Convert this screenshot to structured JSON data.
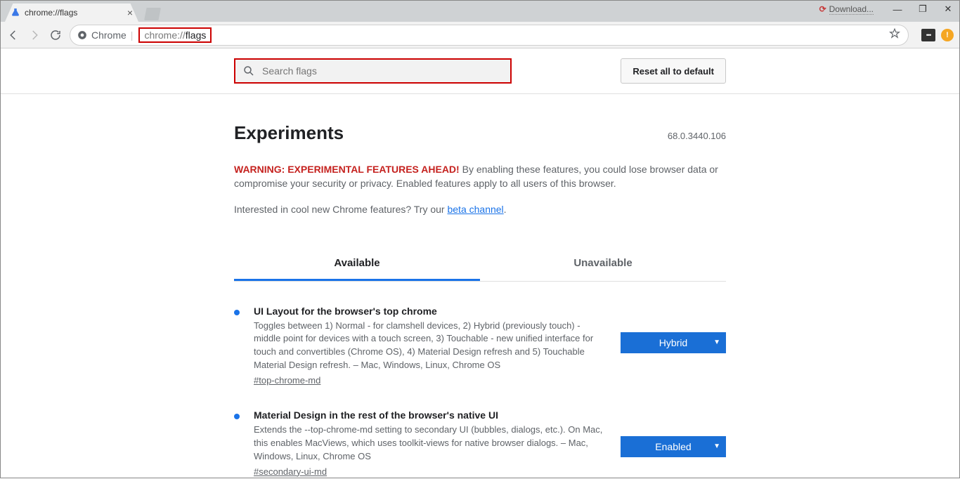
{
  "window": {
    "tab_title": "chrome://flags",
    "download_label": "Download...",
    "minimize": "—",
    "maximize": "❐",
    "close": "✕"
  },
  "toolbar": {
    "chip_label": "Chrome",
    "url_prefix": "chrome://",
    "url_suffix": "flags"
  },
  "search": {
    "placeholder": "Search flags"
  },
  "buttons": {
    "reset_label": "Reset all to default"
  },
  "header": {
    "title": "Experiments",
    "version": "68.0.3440.106"
  },
  "warning": {
    "strong": "WARNING: EXPERIMENTAL FEATURES AHEAD!",
    "rest": " By enabling these features, you could lose browser data or compromise your security or privacy. Enabled features apply to all users of this browser."
  },
  "beta": {
    "text": "Interested in cool new Chrome features? Try our ",
    "link": "beta channel",
    "period": "."
  },
  "tabs": {
    "available": "Available",
    "unavailable": "Unavailable"
  },
  "flags": [
    {
      "title": "UI Layout for the browser's top chrome",
      "desc": "Toggles between 1) Normal - for clamshell devices, 2) Hybrid (previously touch) - middle point for devices with a touch screen, 3) Touchable - new unified interface for touch and convertibles (Chrome OS), 4) Material Design refresh and 5) Touchable Material Design refresh. – Mac, Windows, Linux, Chrome OS",
      "hash": "#top-chrome-md",
      "value": "Hybrid"
    },
    {
      "title": "Material Design in the rest of the browser's native UI",
      "desc": "Extends the --top-chrome-md setting to secondary UI (bubbles, dialogs, etc.). On Mac, this enables MacViews, which uses toolkit-views for native browser dialogs. – Mac, Windows, Linux, Chrome OS",
      "hash": "#secondary-ui-md",
      "value": "Enabled"
    }
  ]
}
